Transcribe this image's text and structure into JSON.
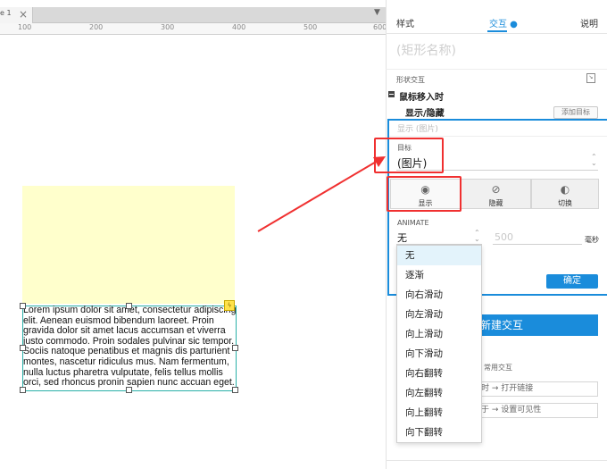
{
  "tab": {
    "label": "e 1",
    "close": "×"
  },
  "ruler": {
    "labels": [
      "100",
      "200",
      "300",
      "400",
      "500",
      "600"
    ]
  },
  "canvas": {
    "text_lines": [
      "Lorem ipsum dolor sit amet, consectetur adipiscing",
      "elit. Aenean euismod bibendum laoreet. Proin",
      "gravida dolor sit amet lacus accumsan et viverra",
      "justo commodo. Proin sodales pulvinar sic tempor.",
      "Sociis natoque penatibus et magnis dis parturient",
      "montes, nascetur ridiculus mus. Nam fermentum,",
      "nulla luctus pharetra vulputate, felis tellus mollis",
      "orci, sed rhoncus pronin sapien nunc accuan eget."
    ]
  },
  "panel": {
    "tabs": {
      "style": "样式",
      "interaction": "交互 ●",
      "notes": "说明"
    },
    "shape_name_placeholder": "(矩形名称)",
    "section_title": "形状交互",
    "event": "鼠标移入时",
    "action": "显示/隐藏",
    "add_target": "添加目标",
    "summary": "显示 (图片)",
    "target_label": "目标",
    "target_value": "(图片)",
    "actions": [
      {
        "label": "显示",
        "icon": "eye-icon",
        "glyph": "◉"
      },
      {
        "label": "隐藏",
        "icon": "eye-slash-icon",
        "glyph": "⊘"
      },
      {
        "label": "切换",
        "icon": "eye-toggle-icon",
        "glyph": "◐"
      }
    ],
    "animate_label": "ANIMATE",
    "animate_value": "无",
    "duration_value": "500",
    "duration_unit": "毫秒",
    "animate_options": [
      "无",
      "逐渐",
      "向右滑动",
      "向左滑动",
      "向上滑动",
      "向下滑动",
      "向右翻转",
      "向左翻转",
      "向上翻转",
      "向下翻转"
    ],
    "confirm": "确定",
    "new_interaction": "新建交互",
    "common_label": "常用交互",
    "common_items": [
      "时 → 打开链接",
      "于 → 设置可见性"
    ]
  }
}
